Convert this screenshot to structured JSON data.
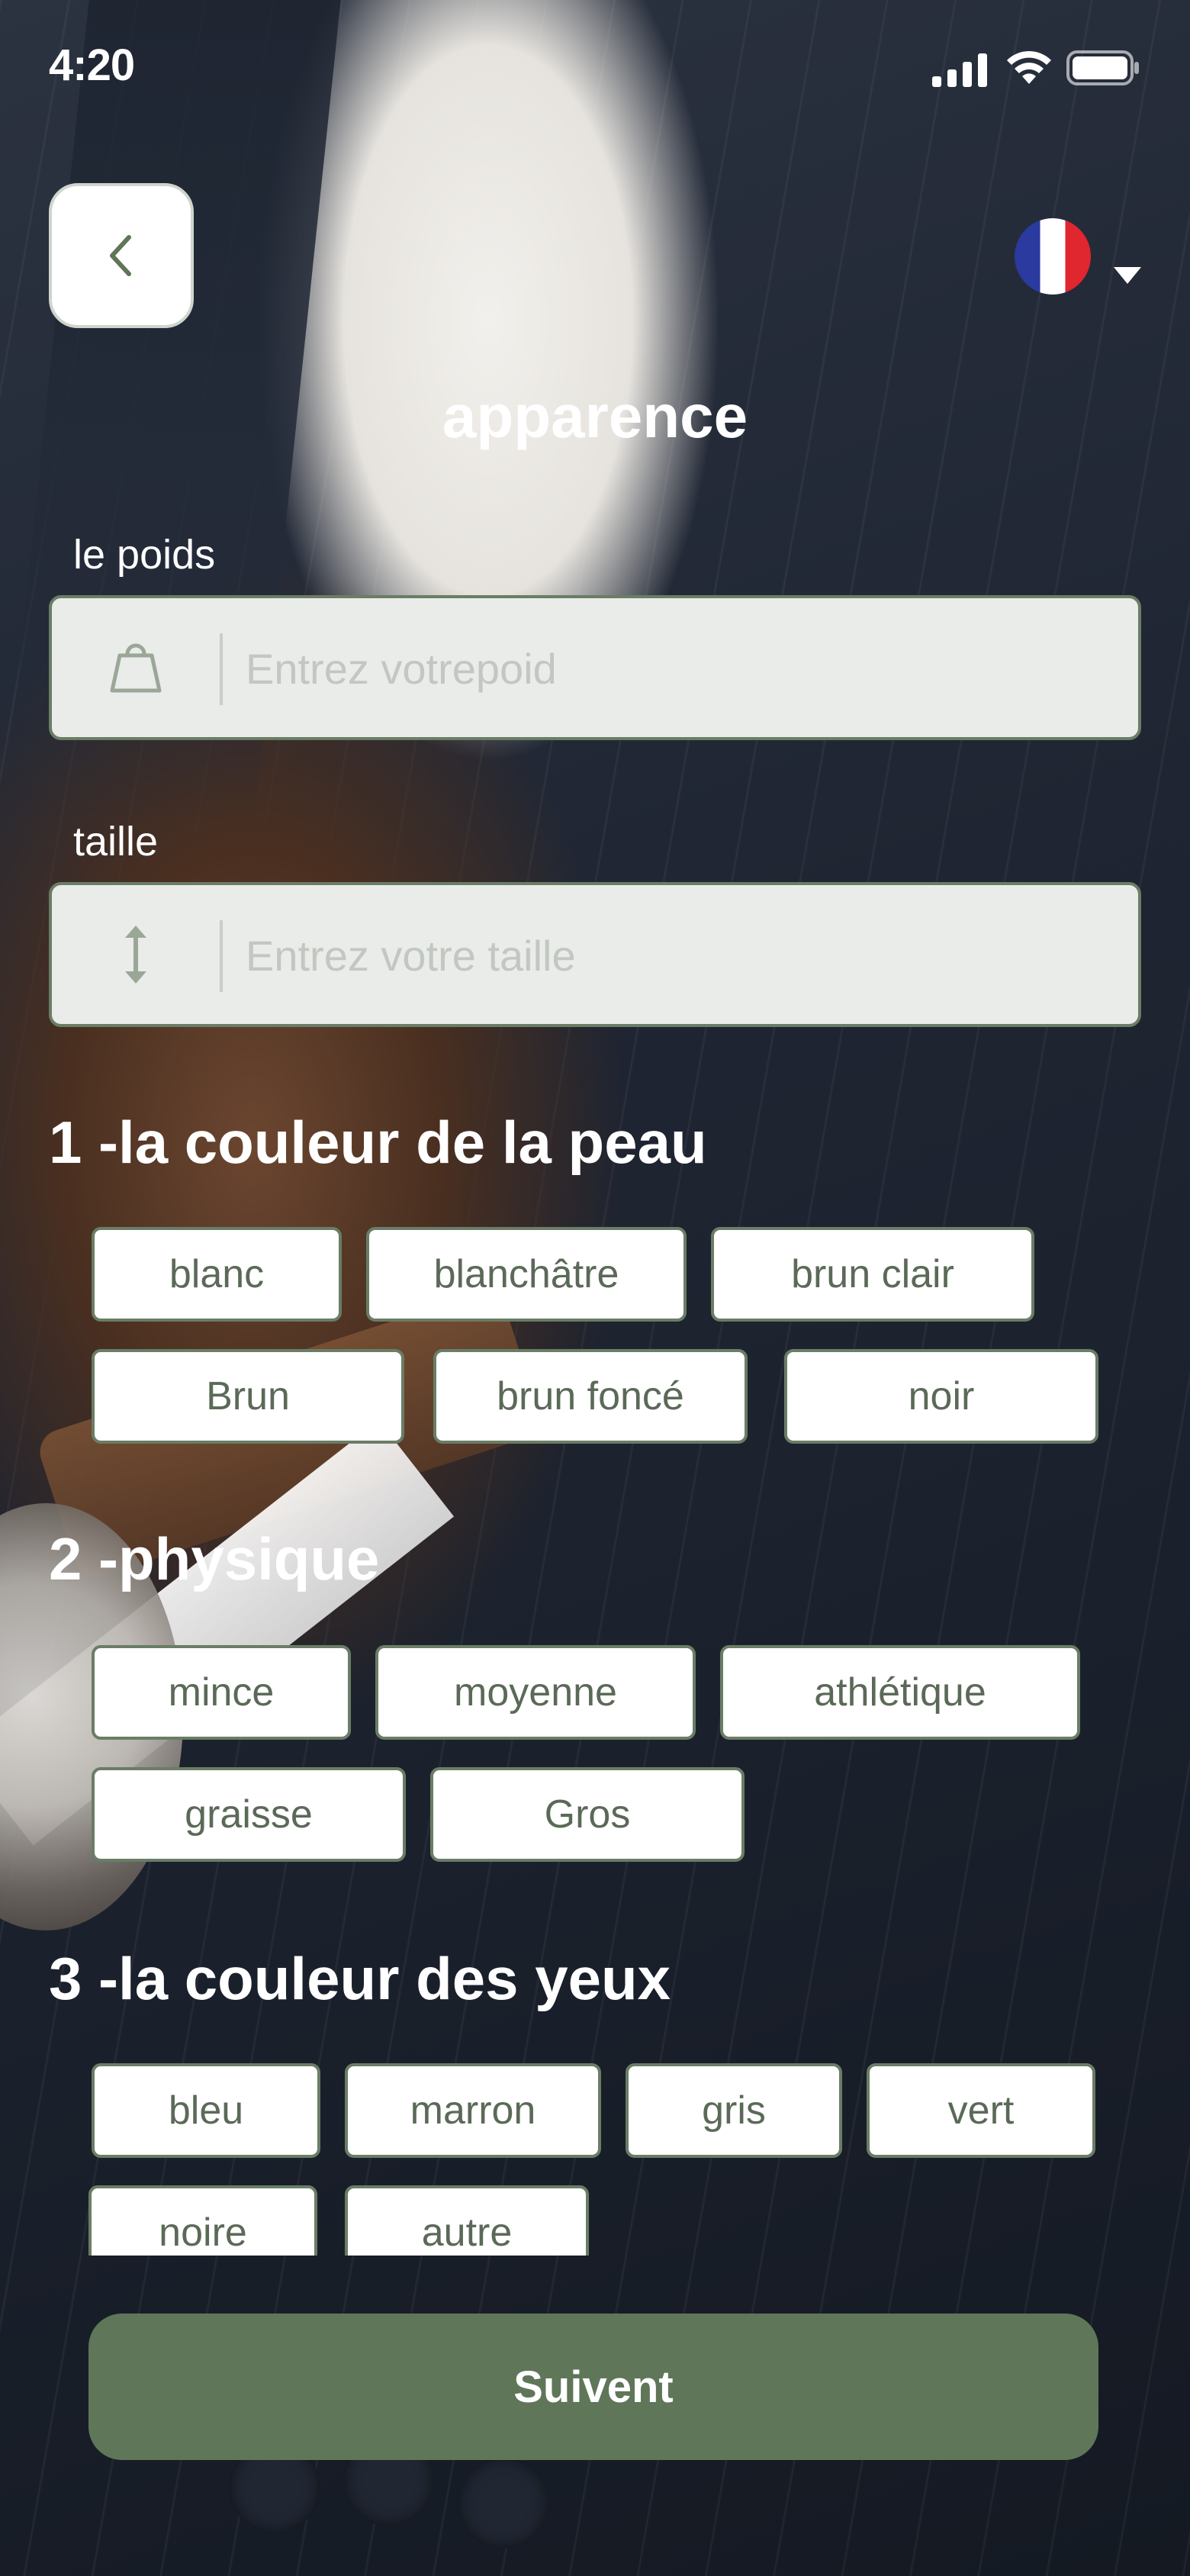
{
  "status_bar": {
    "time": "4:20"
  },
  "header": {
    "back_icon": "chevron-left-icon",
    "language_flag": "france-flag-icon",
    "title": "apparence"
  },
  "weight": {
    "label": "le poids",
    "placeholder": "Entrez votrepoid",
    "icon": "weight-icon"
  },
  "height": {
    "label": "taille",
    "placeholder": "Entrez votre taille",
    "icon": "vertical-arrows-icon"
  },
  "skin": {
    "title": "1 -la couleur de la peau",
    "options": [
      "blanc",
      "blanchâtre",
      "brun clair",
      "Brun",
      "brun foncé",
      "noir"
    ]
  },
  "physique": {
    "title": "2 -physique",
    "options": [
      "mince",
      "moyenne",
      "athlétique",
      "graisse",
      "Gros"
    ]
  },
  "eyes": {
    "title": "3 -la couleur des yeux",
    "options": [
      "bleu",
      "marron",
      "gris",
      "vert",
      "noire",
      "autre"
    ]
  },
  "footer": {
    "next_label": "Suivent"
  },
  "colors": {
    "accent": "#5f7659",
    "chip_text": "#5b6a58",
    "field_bg": "#e9ece8"
  }
}
